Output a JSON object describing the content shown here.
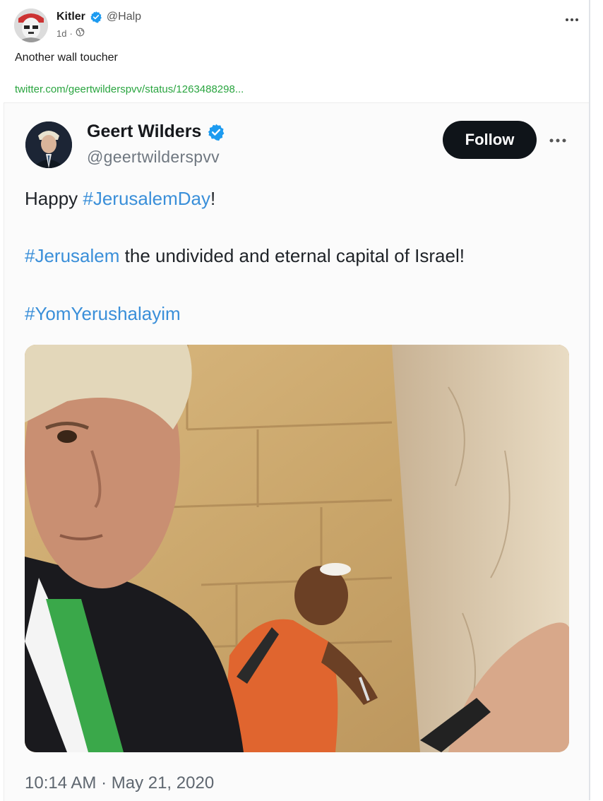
{
  "post": {
    "author_name": "Kitler",
    "author_handle": "@Halp",
    "age": "1d",
    "separator": "·",
    "text": "Another wall toucher",
    "link_text": "twitter.com/geertwilderspvv/status/1263488298..."
  },
  "embedded_tweet": {
    "name": "Geert Wilders",
    "handle": "@geertwilderspvv",
    "follow_label": "Follow",
    "line1": {
      "prefix": "Happy ",
      "hashtag": "#JerusalemDay",
      "suffix": "!"
    },
    "line2": {
      "hashtag": "#Jerusalem",
      "suffix": " the undivided and eternal capital of Israel!"
    },
    "line3": {
      "hashtag": "#YomYerushalayim"
    },
    "timestamp": "10:14 AM · May 21, 2020"
  },
  "colors": {
    "verified": "#1d9bf0",
    "hashtag": "#3a8fd9",
    "link": "#2aa540",
    "follow_bg": "#0f1419"
  },
  "icons": {
    "verified": "verified-badge-icon",
    "more": "more-dots-icon",
    "visibility": "globe-icon"
  }
}
